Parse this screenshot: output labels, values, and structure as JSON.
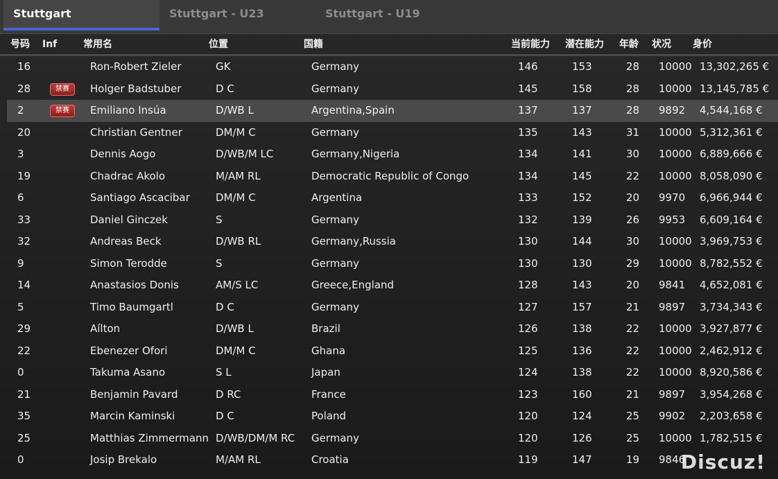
{
  "tabs": [
    {
      "label": "Stuttgart",
      "active": true
    },
    {
      "label": "Stuttgart - U23",
      "active": false
    },
    {
      "label": "Stuttgart - U19",
      "active": false
    }
  ],
  "columns": {
    "number": "号码",
    "inf": "Inf",
    "name": "常用名",
    "position": "位置",
    "nationality": "国籍",
    "current_ability": "当前能力",
    "potential_ability": "潜在能力",
    "age": "年龄",
    "condition": "状况",
    "value": "身价"
  },
  "colors": {
    "accent": "#4c64d8",
    "badge": "#a82828"
  },
  "players": [
    {
      "number": "16",
      "inf": "",
      "name": "Ron-Robert Zieler",
      "position": "GK",
      "nationality": "Germany",
      "ca": "146",
      "pa": "153",
      "age": "28",
      "condition": "10000",
      "value": "13,302,265 €"
    },
    {
      "number": "28",
      "inf": "禁赛",
      "name": "Holger Badstuber",
      "position": "D C",
      "nationality": "Germany",
      "ca": "145",
      "pa": "158",
      "age": "28",
      "condition": "10000",
      "value": "13,145,785 €"
    },
    {
      "number": "2",
      "inf": "禁赛",
      "name": "Emiliano Insúa",
      "position": "D/WB L",
      "nationality": "Argentina,Spain",
      "ca": "137",
      "pa": "137",
      "age": "28",
      "condition": "9892",
      "value": "4,544,168 €",
      "selected": true
    },
    {
      "number": "20",
      "inf": "",
      "name": "Christian Gentner",
      "position": "DM/M C",
      "nationality": "Germany",
      "ca": "135",
      "pa": "143",
      "age": "31",
      "condition": "10000",
      "value": "5,312,361 €"
    },
    {
      "number": "3",
      "inf": "",
      "name": "Dennis Aogo",
      "position": "D/WB/M LC",
      "nationality": "Germany,Nigeria",
      "ca": "134",
      "pa": "141",
      "age": "30",
      "condition": "10000",
      "value": "6,889,666 €"
    },
    {
      "number": "19",
      "inf": "",
      "name": "Chadrac Akolo",
      "position": "M/AM RL",
      "nationality": "Democratic Republic of Congo",
      "ca": "134",
      "pa": "145",
      "age": "22",
      "condition": "10000",
      "value": "8,058,090 €"
    },
    {
      "number": "6",
      "inf": "",
      "name": "Santiago Ascacibar",
      "position": "DM/M C",
      "nationality": "Argentina",
      "ca": "133",
      "pa": "152",
      "age": "20",
      "condition": "9970",
      "value": "6,966,944 €"
    },
    {
      "number": "33",
      "inf": "",
      "name": "Daniel Ginczek",
      "position": "S",
      "nationality": "Germany",
      "ca": "132",
      "pa": "139",
      "age": "26",
      "condition": "9953",
      "value": "6,609,164 €"
    },
    {
      "number": "32",
      "inf": "",
      "name": "Andreas Beck",
      "position": "D/WB RL",
      "nationality": "Germany,Russia",
      "ca": "130",
      "pa": "144",
      "age": "30",
      "condition": "10000",
      "value": "3,969,753 €"
    },
    {
      "number": "9",
      "inf": "",
      "name": "Simon Terodde",
      "position": "S",
      "nationality": "Germany",
      "ca": "130",
      "pa": "130",
      "age": "29",
      "condition": "10000",
      "value": "8,782,552 €"
    },
    {
      "number": "14",
      "inf": "",
      "name": "Anastasios Donis",
      "position": "AM/S LC",
      "nationality": "Greece,England",
      "ca": "128",
      "pa": "143",
      "age": "20",
      "condition": "9841",
      "value": "4,652,081 €"
    },
    {
      "number": "5",
      "inf": "",
      "name": "Timo Baumgartl",
      "position": "D C",
      "nationality": "Germany",
      "ca": "127",
      "pa": "157",
      "age": "21",
      "condition": "9897",
      "value": "3,734,343 €"
    },
    {
      "number": "29",
      "inf": "",
      "name": "Aílton",
      "position": "D/WB L",
      "nationality": "Brazil",
      "ca": "126",
      "pa": "138",
      "age": "22",
      "condition": "10000",
      "value": "3,927,877 €"
    },
    {
      "number": "22",
      "inf": "",
      "name": "Ebenezer Ofori",
      "position": "DM/M C",
      "nationality": "Ghana",
      "ca": "125",
      "pa": "136",
      "age": "22",
      "condition": "10000",
      "value": "2,462,912 €"
    },
    {
      "number": "0",
      "inf": "",
      "name": "Takuma Asano",
      "position": "S L",
      "nationality": "Japan",
      "ca": "124",
      "pa": "138",
      "age": "22",
      "condition": "10000",
      "value": "8,920,586 €"
    },
    {
      "number": "21",
      "inf": "",
      "name": "Benjamin Pavard",
      "position": "D RC",
      "nationality": "France",
      "ca": "123",
      "pa": "160",
      "age": "21",
      "condition": "9897",
      "value": "3,954,268 €"
    },
    {
      "number": "35",
      "inf": "",
      "name": "Marcin Kaminski",
      "position": "D C",
      "nationality": "Poland",
      "ca": "120",
      "pa": "124",
      "age": "25",
      "condition": "9902",
      "value": "2,203,658 €"
    },
    {
      "number": "25",
      "inf": "",
      "name": "Matthias Zimmermann",
      "position": "D/WB/DM/M RC",
      "nationality": "Germany",
      "ca": "120",
      "pa": "126",
      "age": "25",
      "condition": "10000",
      "value": "1,782,515 €"
    },
    {
      "number": "0",
      "inf": "",
      "name": "Josip Brekalo",
      "position": "M/AM RL",
      "nationality": "Croatia",
      "ca": "119",
      "pa": "147",
      "age": "19",
      "condition": "9846",
      "value": ""
    }
  ],
  "watermark": "Discuz!"
}
